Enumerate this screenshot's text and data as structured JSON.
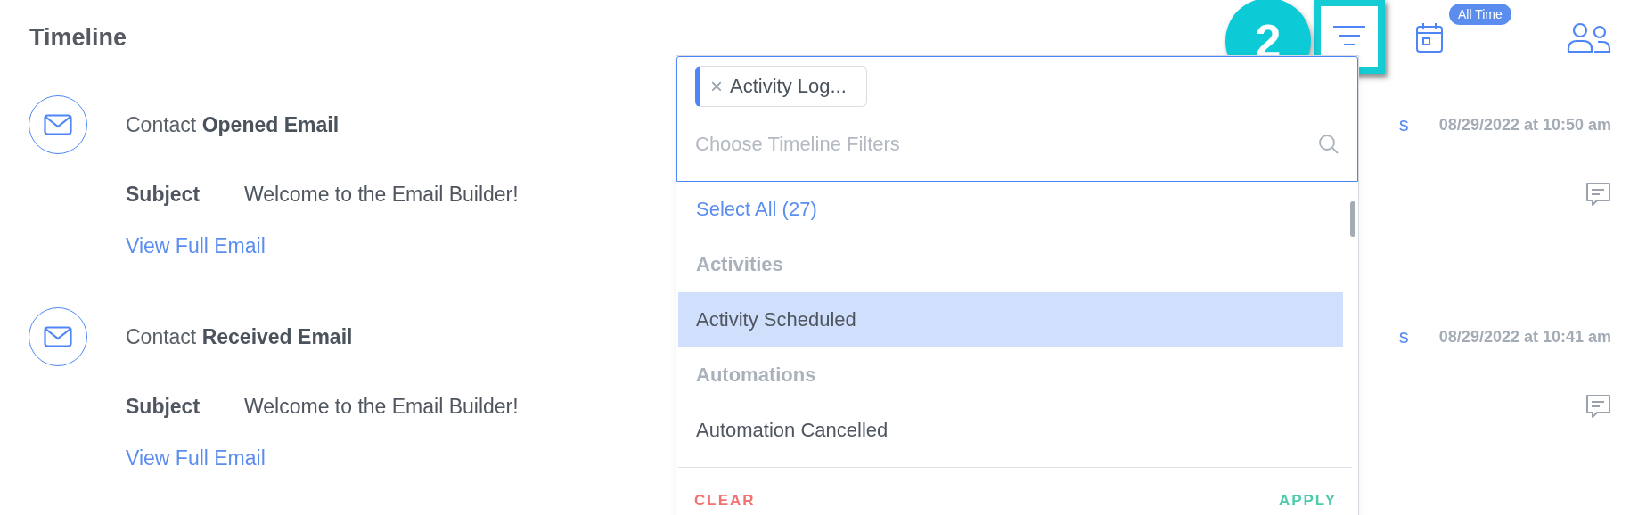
{
  "header": {
    "title": "Timeline",
    "callout": "2",
    "filter_button": {
      "highlighted": true
    },
    "date_range_badge": "All Time"
  },
  "timeline": [
    {
      "prefix": "Contact ",
      "event": "Opened Email",
      "subject_label": "Subject",
      "subject": "Welcome to the Email Builder!",
      "link": "View Full Email",
      "hidden_link_fragment": "s",
      "date": "08/29/2022 at 10:50 am"
    },
    {
      "prefix": "Contact ",
      "event": "Received Email",
      "subject_label": "Subject",
      "subject": "Welcome to the Email Builder!",
      "link": "View Full Email",
      "hidden_link_fragment": "s",
      "date": "08/29/2022 at 10:41 am"
    }
  ],
  "filter_dropdown": {
    "chips": [
      {
        "remove": "×",
        "label": "Activity Log..."
      }
    ],
    "placeholder": "Choose Timeline Filters",
    "options": [
      {
        "kind": "action",
        "label": "Select All (27)",
        "selected": false
      },
      {
        "kind": "group",
        "label": "Activities",
        "selected": false
      },
      {
        "kind": "option",
        "label": "Activity Scheduled",
        "selected": true
      },
      {
        "kind": "group",
        "label": "Automations",
        "selected": false
      },
      {
        "kind": "option",
        "label": "Automation Cancelled",
        "selected": false
      }
    ],
    "clear": "CLEAR",
    "apply": "APPLY"
  }
}
